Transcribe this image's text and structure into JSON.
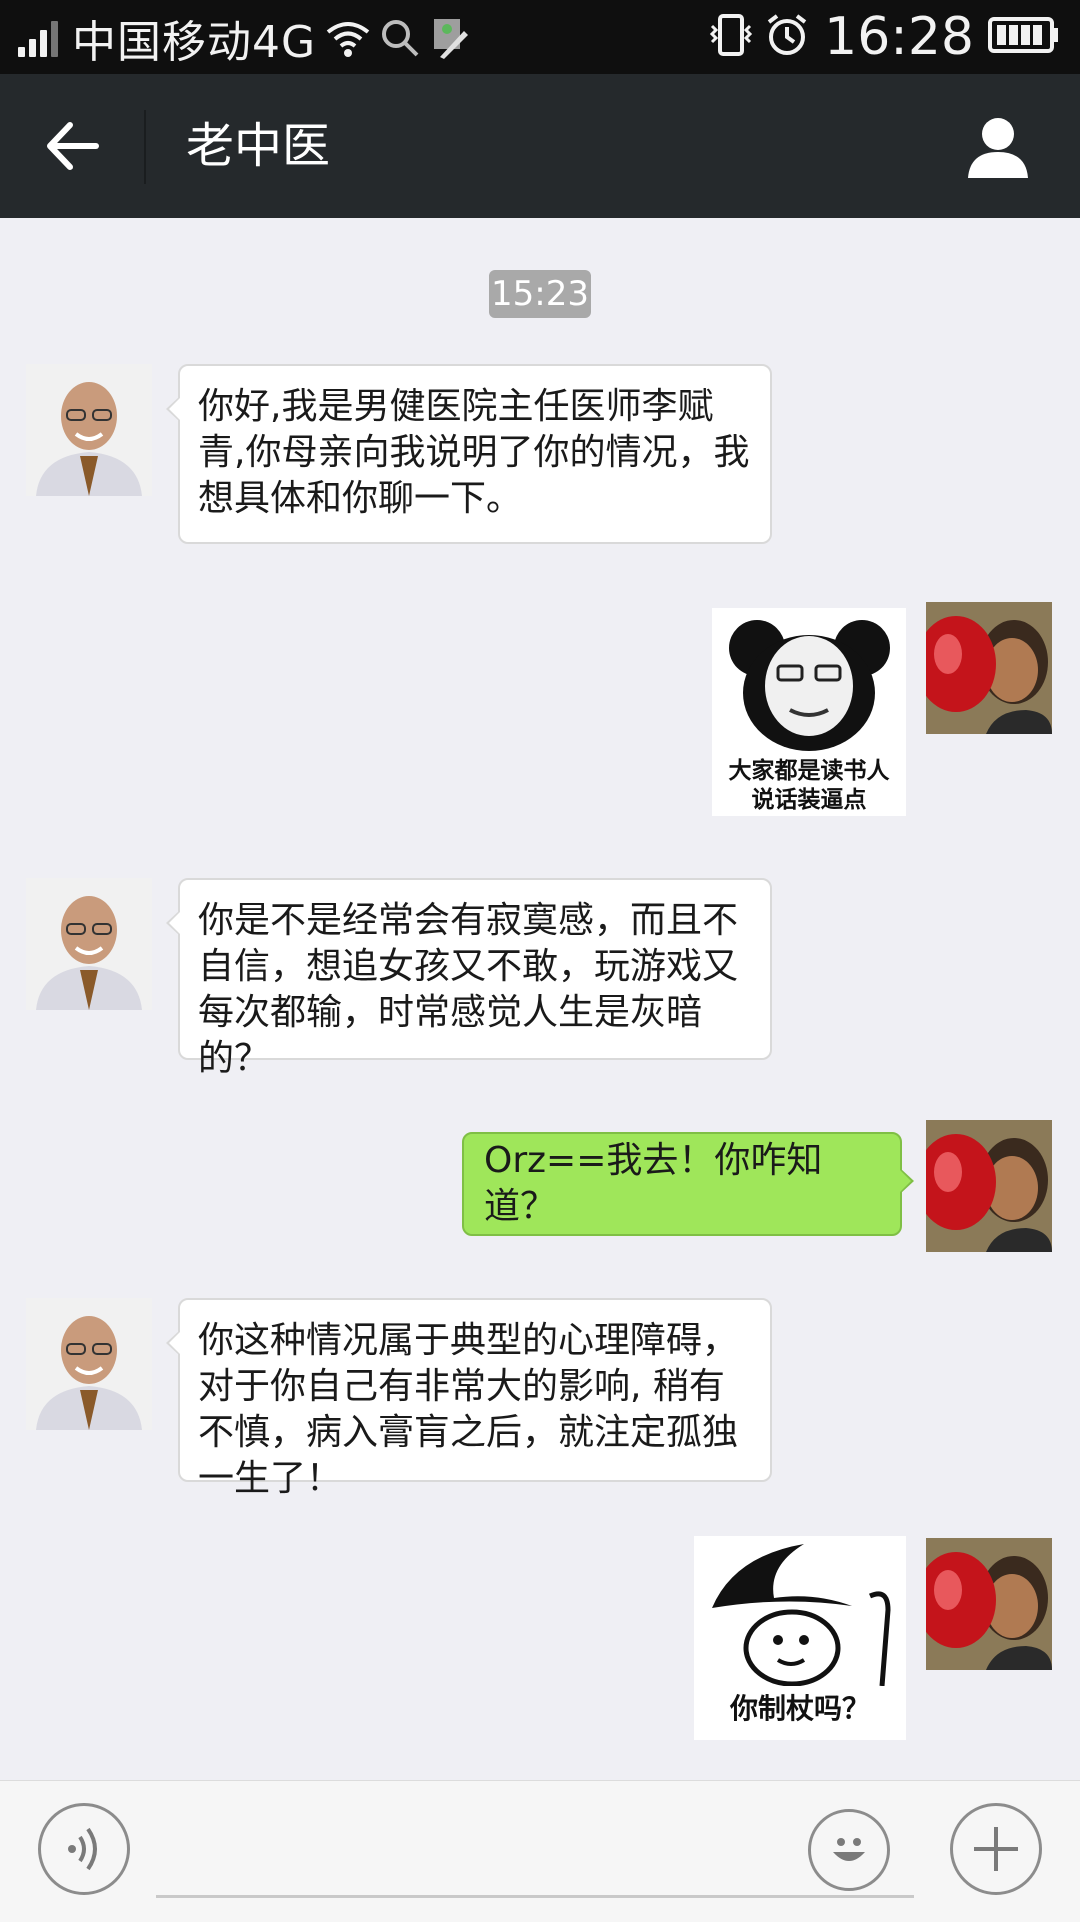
{
  "status_bar": {
    "carrier": "中国移动4G",
    "time": "16:28",
    "icons": [
      "signal-icon",
      "wifi-icon",
      "search-icon",
      "notification-icon",
      "vibrate-icon",
      "alarm-icon",
      "battery-icon"
    ]
  },
  "header": {
    "title": "老中医",
    "back_icon": "arrow-left-icon",
    "profile_icon": "person-icon"
  },
  "chat": {
    "timestamp": "15:23",
    "messages": [
      {
        "sender": "doctor",
        "type": "text",
        "text": "你好,我是男健医院主任医师李赋青,你母亲向我说明了你的情况，我想具体和你聊一下。"
      },
      {
        "sender": "me",
        "type": "sticker",
        "caption": "大家都是读书人\n说话装逼点"
      },
      {
        "sender": "doctor",
        "type": "text",
        "text": "你是不是经常会有寂寞感，而且不自信，想追女孩又不敢，玩游戏又每次都输，时常感觉人生是灰暗的？"
      },
      {
        "sender": "me",
        "type": "text",
        "text": "Orz==我去！你咋知道？"
      },
      {
        "sender": "doctor",
        "type": "text",
        "text": "你这种情况属于典型的心理障碍，对于你自己有非常大的影响, 稍有不慎，病入膏肓之后，就注定孤独一生了！"
      },
      {
        "sender": "me",
        "type": "sticker",
        "caption": "你制杖吗？"
      }
    ]
  },
  "input_bar": {
    "voice_icon": "voice-icon",
    "emoji_icon": "emoji-icon",
    "plus_icon": "plus-icon"
  },
  "colors": {
    "status_bar": "#0f0f0f",
    "nav_bar": "#25292c",
    "chat_bg": "#efeff4",
    "bubble_in": "#ffffff",
    "bubble_out": "#9fe65a"
  }
}
